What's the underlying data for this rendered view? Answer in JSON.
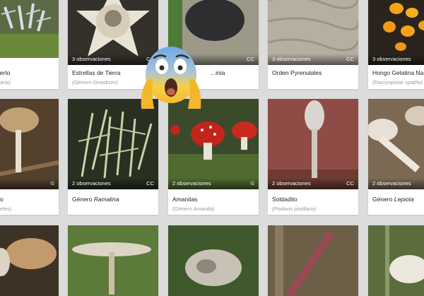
{
  "cards": [
    {
      "title": "Muerto",
      "title_genus": "",
      "subtitle": "...alaria)",
      "observations": "",
      "cc": ""
    },
    {
      "title": "Estrellas de Tierra",
      "title_genus": "",
      "subtitle": "(Género Geastrum)",
      "observations": "3 observaciones",
      "cc": "CC"
    },
    {
      "title": "...inia",
      "title_genus": "",
      "subtitle": "",
      "observations": "",
      "cc": "CC"
    },
    {
      "title": "Orden Pyrenulales",
      "title_genus": "",
      "subtitle": "",
      "observations": "3 observaciones",
      "cc": "CC"
    },
    {
      "title": "Hongo Gelatina Na...",
      "title_genus": "",
      "subtitle": "(Dacryopinax spathul...",
      "observations": "3 observaciones",
      "cc": ""
    },
    {
      "title": "o",
      "title_genus": "",
      "subtitle": "...eletes)",
      "observations": "",
      "cc": "©"
    },
    {
      "title": "Género ",
      "title_genus": "Ramalina",
      "subtitle": "",
      "observations": "2 observaciones",
      "cc": "CC"
    },
    {
      "title": "Amanitas",
      "title_genus": "",
      "subtitle": "(Género Amanita)",
      "observations": "2 observaciones",
      "cc": "©"
    },
    {
      "title": "Soldadito",
      "title_genus": "",
      "subtitle": "(Podaxis pistillaris)",
      "observations": "2 observaciones",
      "cc": "CC"
    },
    {
      "title": "Género ",
      "title_genus": "Lepiota",
      "subtitle": "",
      "observations": "2 observaciones",
      "cc": ""
    },
    {
      "title": "",
      "title_genus": "",
      "subtitle": "",
      "observations": "",
      "cc": ""
    },
    {
      "title": "",
      "title_genus": "",
      "subtitle": "",
      "observations": "",
      "cc": ""
    },
    {
      "title": "",
      "title_genus": "",
      "subtitle": "",
      "observations": "",
      "cc": ""
    },
    {
      "title": "",
      "title_genus": "",
      "subtitle": "",
      "observations": "",
      "cc": ""
    },
    {
      "title": "",
      "title_genus": "",
      "subtitle": "",
      "observations": "",
      "cc": ""
    }
  ],
  "emoji_icon": "screaming-face-icon"
}
